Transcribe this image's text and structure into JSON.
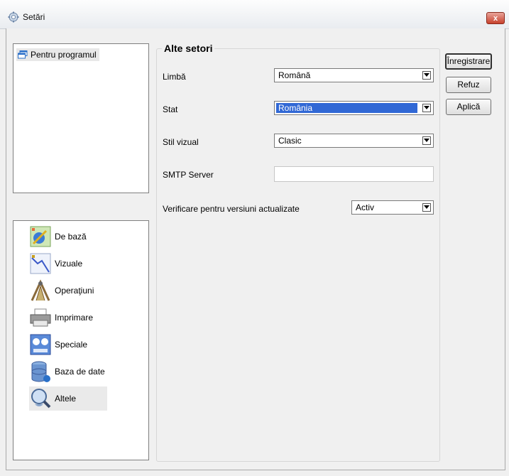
{
  "window": {
    "title": "Setări",
    "close_label": "x"
  },
  "tree": {
    "items": [
      {
        "label": "Pentru programul"
      }
    ]
  },
  "categories": [
    {
      "label": "De bază",
      "icon": "basic-settings-icon"
    },
    {
      "label": "Vizuale",
      "icon": "visual-chart-icon"
    },
    {
      "label": "Operaţiuni",
      "icon": "operations-tools-icon"
    },
    {
      "label": "Imprimare",
      "icon": "printer-icon"
    },
    {
      "label": "Speciale",
      "icon": "special-settings-icon"
    },
    {
      "label": "Baza de date",
      "icon": "database-icon"
    },
    {
      "label": "Altele",
      "icon": "magnifier-icon",
      "selected": true
    }
  ],
  "settings": {
    "group_title": "Alte setori",
    "language": {
      "label": "Limbă",
      "value": "Română"
    },
    "country": {
      "label": "Stat",
      "value": "România"
    },
    "visual_style": {
      "label": "Stil vizual",
      "value": "Clasic"
    },
    "smtp": {
      "label": "SMTP Server",
      "value": ""
    },
    "updates": {
      "label": "Verificare pentru versiuni actualizate",
      "value": "Activ"
    }
  },
  "buttons": {
    "save": "Înregistrare",
    "refuse": "Refuz",
    "apply": "Aplică"
  },
  "colors": {
    "selection": "#3168d5",
    "close_button": "#c7412d"
  }
}
